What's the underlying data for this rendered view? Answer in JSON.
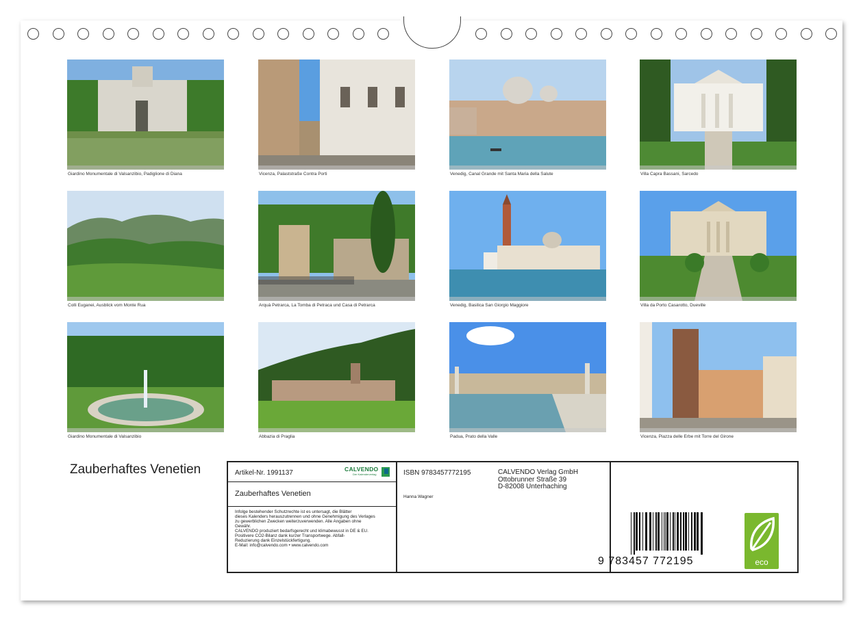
{
  "calendar": {
    "title": "Zauberhaftes Venetien",
    "photos": [
      {
        "caption": "Giardino Monumentale di Valsanzibio, Padiglione di Diana",
        "icon": "villa-garden-pond"
      },
      {
        "caption": "Vicenza, Palaststraße Contra Porti",
        "icon": "street-palaces"
      },
      {
        "caption": "Venedig, Canal Grande mit Santa Maria della Salute",
        "icon": "canal-domes"
      },
      {
        "caption": "Villa Capra Bassani, Sarcedo",
        "icon": "villa-portico"
      },
      {
        "caption": "Colli Euganei, Ausblick vom Monte Rua",
        "icon": "hills-landscape"
      },
      {
        "caption": "Arquà Petrarca, La Tomba di Petraca und Casa di Petrarca",
        "icon": "tomb-cypress"
      },
      {
        "caption": "Venedig, Basilica San Giorgio Maggiore",
        "icon": "basilica-lagoon"
      },
      {
        "caption": "Villa da Porto Casarotto, Dueville",
        "icon": "villa-stairs"
      },
      {
        "caption": "Giardino Monumentale di Valsanzibio",
        "icon": "fountain-garden"
      },
      {
        "caption": "Abbazia di Praglia",
        "icon": "abbey-hills"
      },
      {
        "caption": "Padua, Prato della Valle",
        "icon": "canal-statues"
      },
      {
        "caption": "Vicenza, Piazza delle Erbe mit Torre del Girone",
        "icon": "tower-square"
      }
    ]
  },
  "imprint": {
    "article": "Artikel-Nr. 1991137",
    "logo_text": "CALVENDO",
    "logo_sub": "Der Kalenderverlag",
    "book_title": "Zauberhaftes Venetien",
    "legal_lines": [
      "Infolge bestehender Schutzrechte ist es untersagt, die Blätter",
      "dieses Kalenders herauszutrennen und ohne Genehmigung des Verlages",
      "zu gewerblichen Zwecken weiterzuverwenden. Alle Angaben ohne",
      "Gewähr.",
      "CALVENDO produziert bedarfsgerecht und klimabewusst in DE & EU.",
      "Positivere CO2-Bilanz dank kurzer Transportwege. Abfall-",
      "Reduzierung dank Einzelstückfertigung.",
      "E-Mail: info@calvendo.com • www.calvendo.com"
    ],
    "isbn": "ISBN 9783457772195",
    "author": "Hanna Wagner",
    "publisher_lines": [
      "CALVENDO Verlag GmbH",
      "Ottobrunner Straße 39",
      "D-82008 Unterhaching"
    ],
    "barcode_number": "9 783457 772195",
    "eco_label": "eco",
    "colors": {
      "logo_green": "#1a7a3a",
      "eco_green": "#7ab82e"
    }
  }
}
